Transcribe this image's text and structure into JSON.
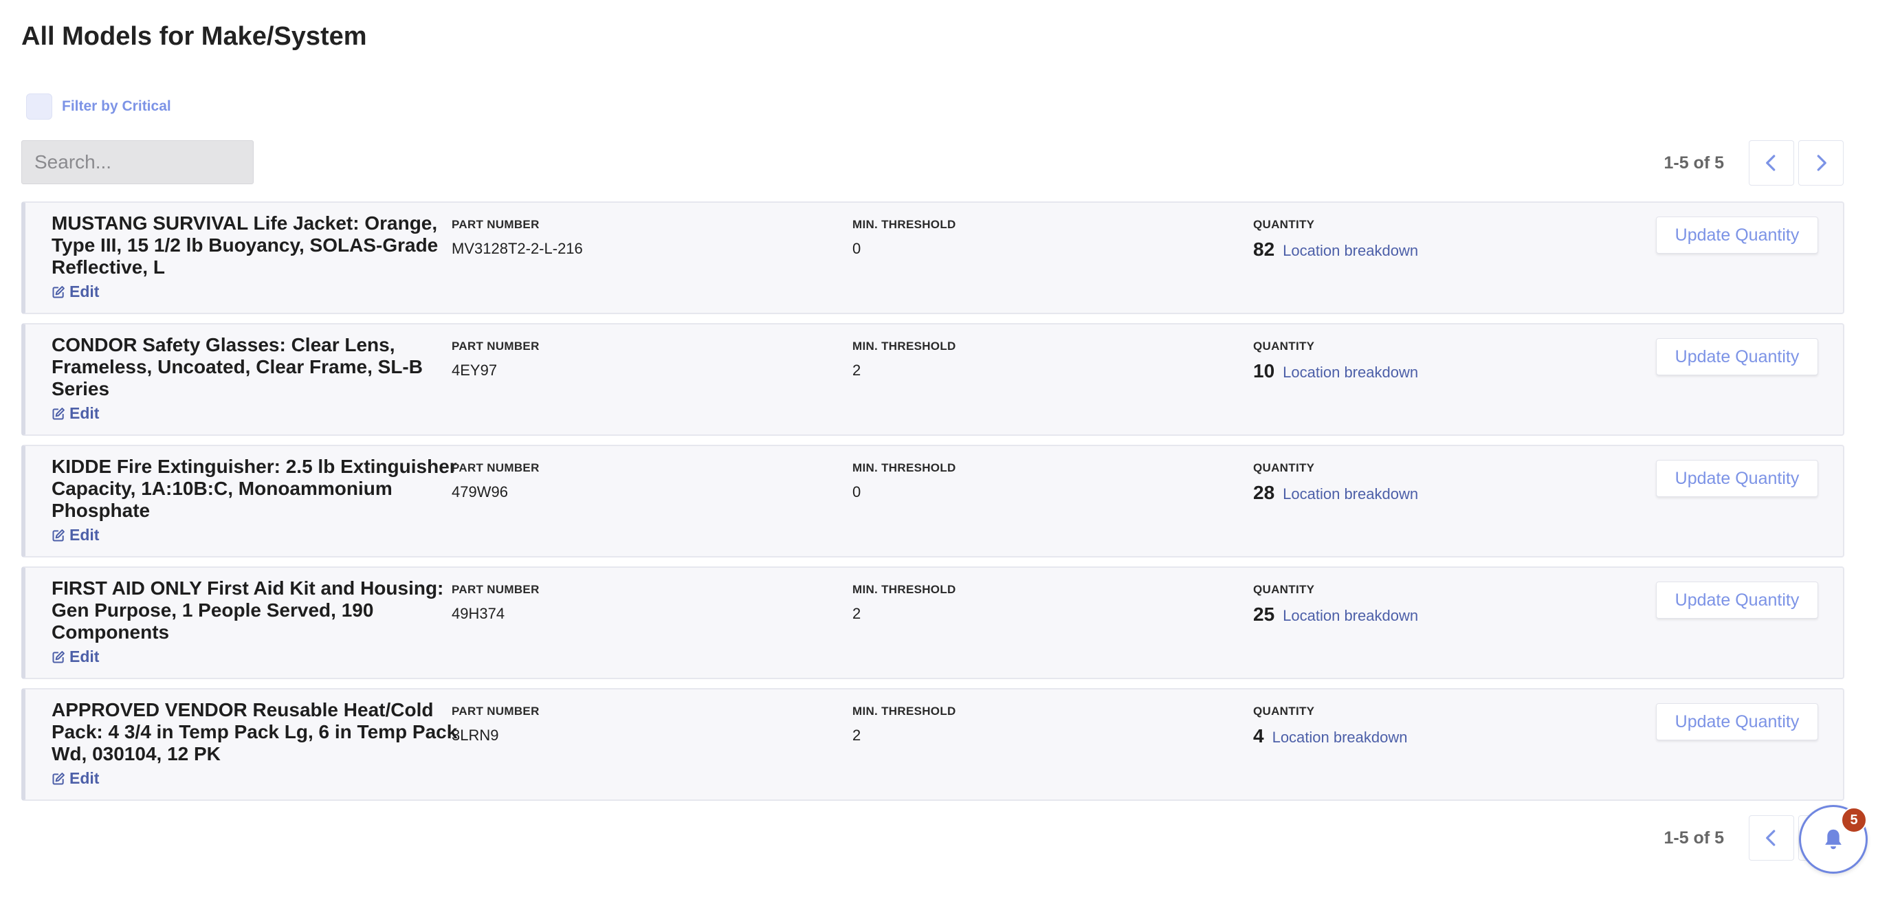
{
  "page": {
    "title": "All Models for Make/System"
  },
  "filter": {
    "label": "Filter by Critical"
  },
  "search": {
    "placeholder": "Search..."
  },
  "pagination": {
    "range_text": "1-5 of 5"
  },
  "columns": {
    "part_number": "PART NUMBER",
    "min_threshold": "MIN. THRESHOLD",
    "quantity": "QUANTITY"
  },
  "actions": {
    "edit_label": "Edit",
    "update_label": "Update Quantity",
    "location_label": "Location breakdown"
  },
  "items": [
    {
      "name": "MUSTANG SURVIVAL Life Jacket: Orange, Type III, 15 1/2 lb Buoyancy, SOLAS-Grade Reflective, L",
      "part_number": "MV3128T2-2-L-216",
      "min_threshold": "0",
      "quantity": "82"
    },
    {
      "name": "CONDOR Safety Glasses: Clear Lens, Frameless, Uncoated, Clear Frame, SL-B Series",
      "part_number": "4EY97",
      "min_threshold": "2",
      "quantity": "10"
    },
    {
      "name": "KIDDE Fire Extinguisher: 2.5 lb Extinguisher Capacity, 1A:10B:C, Monoammonium Phosphate",
      "part_number": "479W96",
      "min_threshold": "0",
      "quantity": "28"
    },
    {
      "name": "FIRST AID ONLY First Aid Kit and Housing: Gen Purpose, 1 People Served, 190 Components",
      "part_number": "49H374",
      "min_threshold": "2",
      "quantity": "25"
    },
    {
      "name": "APPROVED VENDOR Reusable Heat/Cold Pack: 4 3/4 in Temp Pack Lg, 6 in Temp Pack Wd, 030104, 12 PK",
      "part_number": "3LRN9",
      "min_threshold": "2",
      "quantity": "4"
    }
  ],
  "notifications": {
    "count": "5",
    "icon": "bell-icon"
  },
  "colors": {
    "accent": "#7c93e6",
    "link": "#4c5fa8",
    "badge": "#b8401f"
  }
}
